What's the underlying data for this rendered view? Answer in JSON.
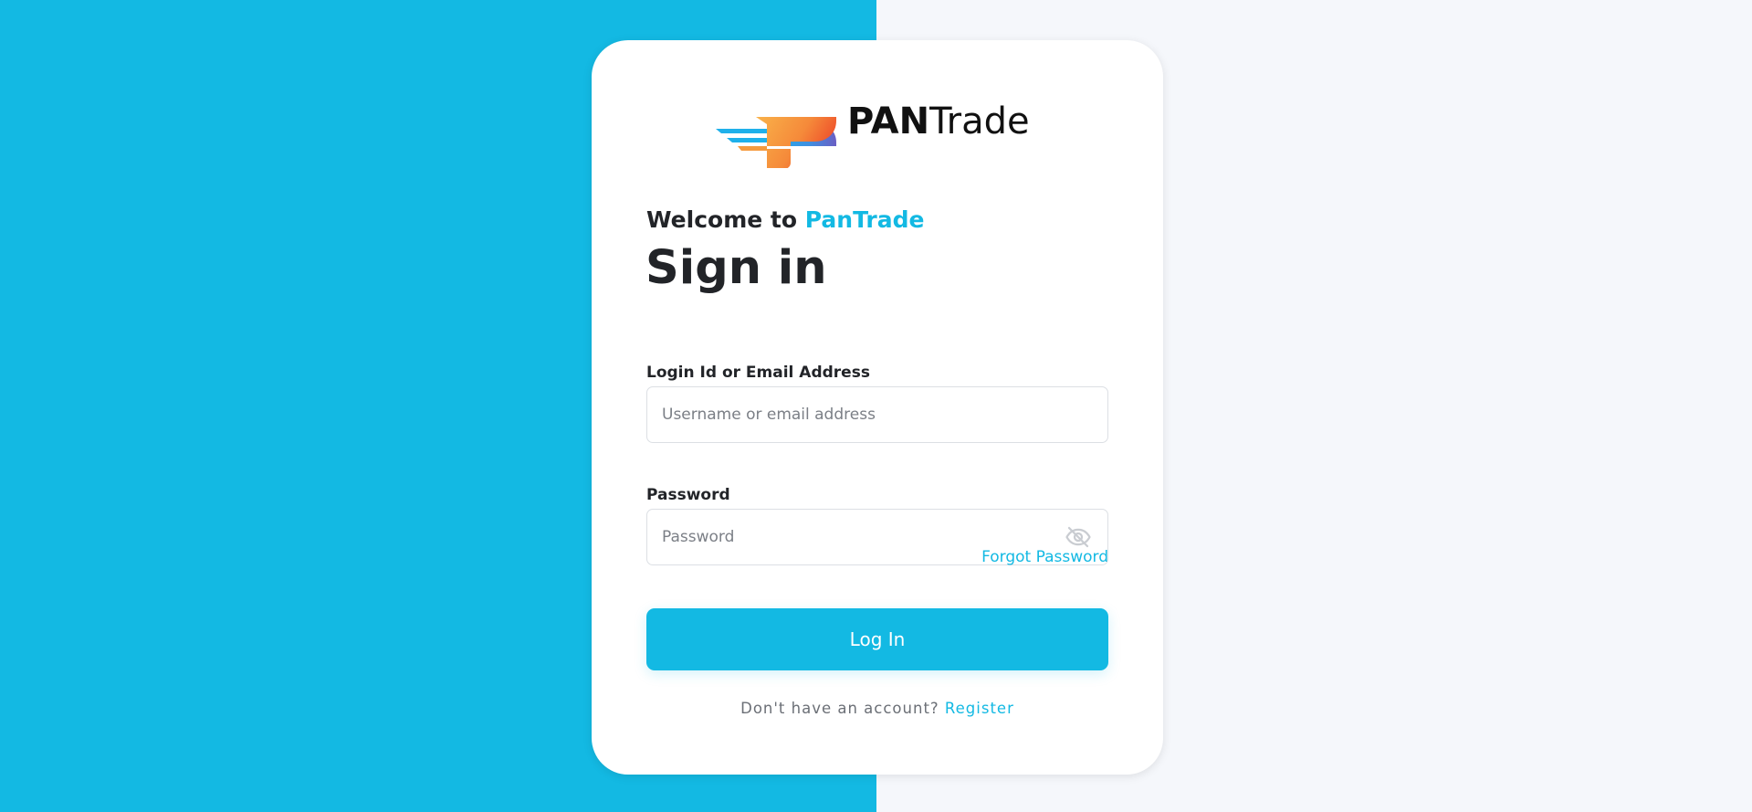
{
  "brand": {
    "logo_text_bold": "PAN",
    "logo_text_light": "Trade",
    "logo_icon": "pantrade-logo-icon",
    "accent_color": "#13b9e3"
  },
  "header": {
    "welcome_prefix": "Welcome to",
    "welcome_brand": "PanTrade",
    "title": "Sign in"
  },
  "form": {
    "login_label": "Login Id or Email Address",
    "login_placeholder": "Username or email address",
    "login_value": "",
    "password_label": "Password",
    "password_placeholder": "Password",
    "password_value": "",
    "password_toggle_icon": "eye-off-icon",
    "forgot_label": "Forgot Password",
    "submit_label": "Log In"
  },
  "footer": {
    "prompt": "Don't have an account?",
    "register_label": "Register"
  }
}
